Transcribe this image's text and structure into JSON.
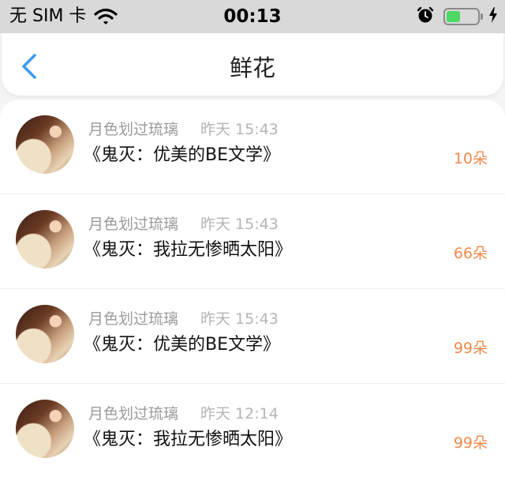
{
  "status_bar": {
    "carrier": "无 SIM 卡",
    "time": "00:13",
    "battery_level": 0.45,
    "icons": [
      "wifi-icon",
      "alarm-clock-icon",
      "battery-icon",
      "charging-bolt-icon"
    ]
  },
  "nav": {
    "title": "鲜花",
    "back_icon": "chevron-left-icon",
    "accent_color": "#3a9bf0"
  },
  "items": [
    {
      "user": "月色划过琉璃",
      "time": "昨天 15:43",
      "book": "《鬼灭：优美的BE文学》",
      "count": "10朵"
    },
    {
      "user": "月色划过琉璃",
      "time": "昨天 15:43",
      "book": "《鬼灭：我拉无惨晒太阳》",
      "count": "66朵"
    },
    {
      "user": "月色划过琉璃",
      "time": "昨天 15:43",
      "book": "《鬼灭：优美的BE文学》",
      "count": "99朵"
    },
    {
      "user": "月色划过琉璃",
      "time": "昨天 12:14",
      "book": "《鬼灭：我拉无惨晒太阳》",
      "count": "99朵"
    }
  ],
  "colors": {
    "count": "#f08a4b",
    "status_bar_bg": "#d9d9d9",
    "battery_fill": "#4cd964"
  }
}
